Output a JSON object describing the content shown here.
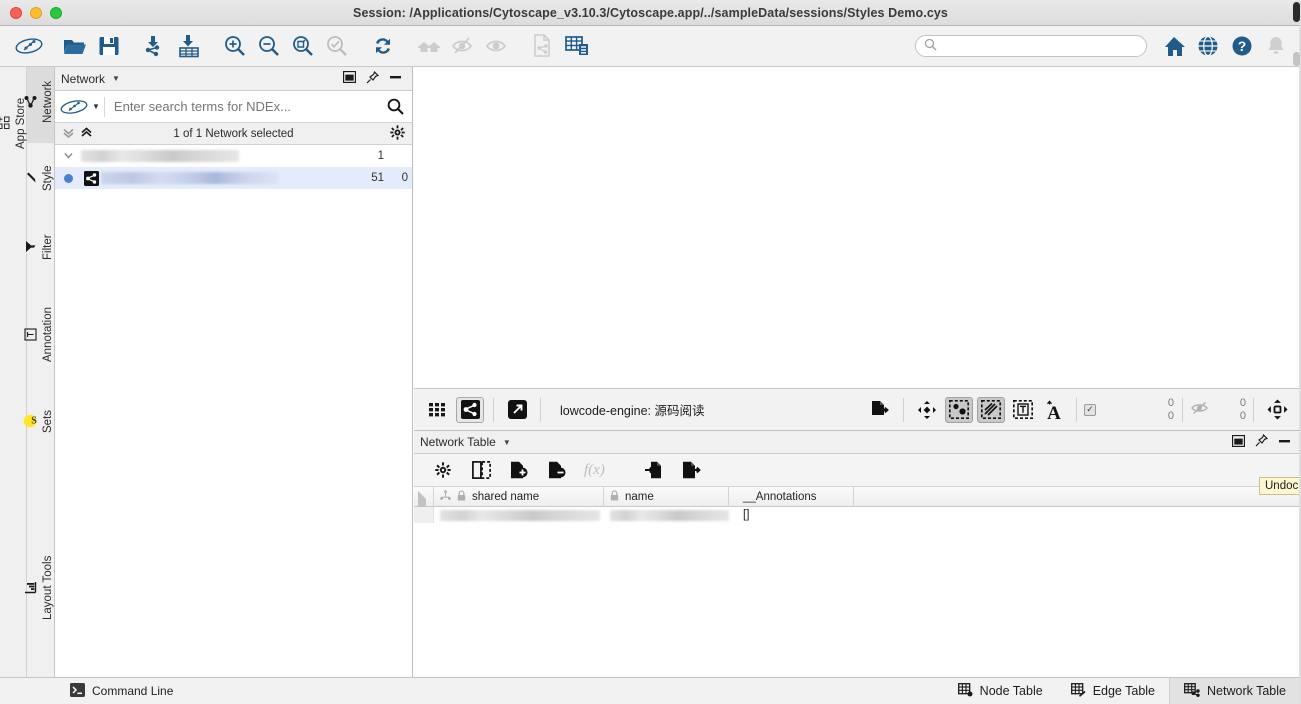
{
  "window": {
    "title": "Session: /Applications/Cytoscape_v3.10.3/Cytoscape.app/../sampleData/sessions/Styles Demo.cys",
    "close_label": "Close",
    "minimize_label": "Minimize",
    "zoom_label": "Zoom"
  },
  "toolbar": {
    "items": [
      {
        "name": "cytoscape-logo-icon",
        "label": "Cytoscape"
      },
      {
        "name": "open-session-icon",
        "label": "Open Session"
      },
      {
        "name": "save-session-icon",
        "label": "Save Session"
      },
      {
        "name": "import-network-icon",
        "label": "Import Network From File"
      },
      {
        "name": "import-table-icon",
        "label": "Import Table From File"
      },
      {
        "name": "zoom-in-icon",
        "label": "Zoom In"
      },
      {
        "name": "zoom-out-icon",
        "label": "Zoom Out"
      },
      {
        "name": "fit-network-icon",
        "label": "Zoom Out to Display All of Current Network"
      },
      {
        "name": "fit-selected-icon",
        "label": "Zoom Selected Region"
      },
      {
        "name": "refresh-icon",
        "label": "Refresh Network"
      },
      {
        "name": "hide-all-icon",
        "label": "Show All Nodes and Edges"
      },
      {
        "name": "hide-selected-icon",
        "label": "Hide Selected Nodes and Edges"
      },
      {
        "name": "show-selected-icon",
        "label": "Show Selected Nodes and Edges"
      },
      {
        "name": "new-network-from-selection-icon",
        "label": "New Network From Selection"
      },
      {
        "name": "destroy-network-icon",
        "label": "Network Table"
      }
    ],
    "search": {
      "placeholder": "",
      "value": ""
    },
    "right_items": [
      {
        "name": "home-icon",
        "label": "Cytoscape Home"
      },
      {
        "name": "globe-icon",
        "label": "Cytoscape Web"
      },
      {
        "name": "help-icon",
        "label": "Help"
      },
      {
        "name": "notification-bell-icon",
        "label": "Notifications"
      }
    ]
  },
  "sidebar": {
    "left_tabs": [
      {
        "name": "app-store",
        "label": "App Store",
        "icon": "app-store-icon",
        "active": false
      }
    ],
    "tabs": [
      {
        "name": "network",
        "label": "Network",
        "icon": "network-icon",
        "active": true
      },
      {
        "name": "style",
        "label": "Style",
        "icon": "style-brush-icon",
        "active": false
      },
      {
        "name": "filter",
        "label": "Filter",
        "icon": "filter-funnel-icon",
        "active": false
      },
      {
        "name": "annotation",
        "label": "Annotation",
        "icon": "annotation-text-icon",
        "active": false
      },
      {
        "name": "sets",
        "label": "Sets",
        "icon": "sets-s-icon",
        "active": false
      },
      {
        "name": "layout-tools",
        "label": "Layout Tools",
        "icon": "layout-tools-icon",
        "active": false
      }
    ]
  },
  "network_panel": {
    "title": "Network",
    "header_actions": [
      {
        "name": "float-panel-icon",
        "label": "Float Window"
      },
      {
        "name": "pin-panel-icon",
        "label": "Dock Window"
      },
      {
        "name": "minimize-panel-icon",
        "label": "Minimize Window"
      }
    ],
    "ndex": {
      "logo": "ndex-logo-icon",
      "placeholder": "Enter search terms for NDEx...",
      "value": "",
      "search_button": "ndex-search-icon"
    },
    "selection_bar": {
      "text": "1 of 1 Network selected",
      "collapse_all": "collapse-all-icon",
      "expand_all": "expand-all-icon",
      "settings": "network-settings-gear-icon"
    },
    "rows": [
      {
        "name": "",
        "level": 0,
        "selected": false,
        "node_count": "1",
        "edge_count": "",
        "redacted": true
      },
      {
        "name": "",
        "level": 1,
        "selected": true,
        "node_count": "51",
        "edge_count": "0",
        "redacted": true
      }
    ]
  },
  "view_toolbar": {
    "mode_buttons": [
      {
        "name": "grid-view-icon",
        "label": "Show Network Thumbnails",
        "active": false
      },
      {
        "name": "network-view-icon",
        "label": "Show Network View",
        "active": true
      },
      {
        "name": "detach-view-icon",
        "label": "Detach Network View",
        "active": false
      }
    ],
    "view_title": "lowcode-engine: 源码阅读",
    "right_buttons": [
      {
        "name": "export-image-icon",
        "label": "Export Network to Image"
      },
      {
        "name": "apply-layout-icon",
        "label": "Apply Preferred Layout"
      },
      {
        "name": "select-nodes-icon",
        "label": "Toggle Node Selection",
        "active": true
      },
      {
        "name": "select-edges-icon",
        "label": "Toggle Edge Selection",
        "active": true
      },
      {
        "name": "select-annotations-icon",
        "label": "Toggle Annotation Selection",
        "active": false
      },
      {
        "name": "node-labels-icon",
        "label": "Toggle Node Labels",
        "active": false
      },
      {
        "name": "fit-content-icon",
        "label": "Fit Content"
      }
    ],
    "checkbox_checked": true,
    "counts": {
      "selected_nodes": "0",
      "selected_edges": "0",
      "hidden_nodes": "0",
      "hidden_edges": "0"
    },
    "hidden_icon": "hidden-elements-icon"
  },
  "table_panel": {
    "title": "Network Table",
    "header_actions": [
      {
        "name": "float-table-icon",
        "label": "Float Window"
      },
      {
        "name": "pin-table-icon",
        "label": "Dock Window"
      },
      {
        "name": "minimize-table-icon",
        "label": "Minimize Window"
      }
    ],
    "tooltip": "Undock",
    "toolbar_buttons": [
      {
        "name": "table-settings-gear-icon",
        "label": "Change Table Mode"
      },
      {
        "name": "toggle-columns-icon",
        "label": "Show/Hide Columns"
      },
      {
        "name": "create-column-icon",
        "label": "Create New Column"
      },
      {
        "name": "delete-column-icon",
        "label": "Delete Columns"
      },
      {
        "name": "function-builder-icon",
        "label": "f(x)",
        "disabled": true
      },
      {
        "name": "import-table-icon",
        "label": "Import Table From File"
      },
      {
        "name": "export-table-icon",
        "label": "Export Table to File"
      }
    ],
    "columns": [
      {
        "name": "shared-name-column",
        "label": "shared name",
        "locked": true,
        "shared": true
      },
      {
        "name": "name-column",
        "label": "name",
        "locked": true,
        "shared": false
      },
      {
        "name": "annotations-column",
        "label": "__Annotations",
        "locked": false,
        "shared": false
      }
    ],
    "rows": [
      {
        "shared_name": "",
        "name": "",
        "annotations": "[]",
        "redacted": true
      }
    ]
  },
  "status_bar": {
    "command_line": {
      "label": "Command Line",
      "icon": "terminal-icon"
    },
    "tabs": [
      {
        "name": "node-table",
        "label": "Node Table",
        "icon": "node-table-icon",
        "active": false
      },
      {
        "name": "edge-table",
        "label": "Edge Table",
        "icon": "edge-table-icon",
        "active": false
      },
      {
        "name": "network-table",
        "label": "Network Table",
        "icon": "network-table-icon",
        "active": true
      }
    ]
  },
  "colors": {
    "accent_blue": "#1f5c8b",
    "selection_blue": "#e4ecfb",
    "chrome_gray": "#f2f2f2",
    "tooltip_yellow": "#fdf6cf"
  }
}
